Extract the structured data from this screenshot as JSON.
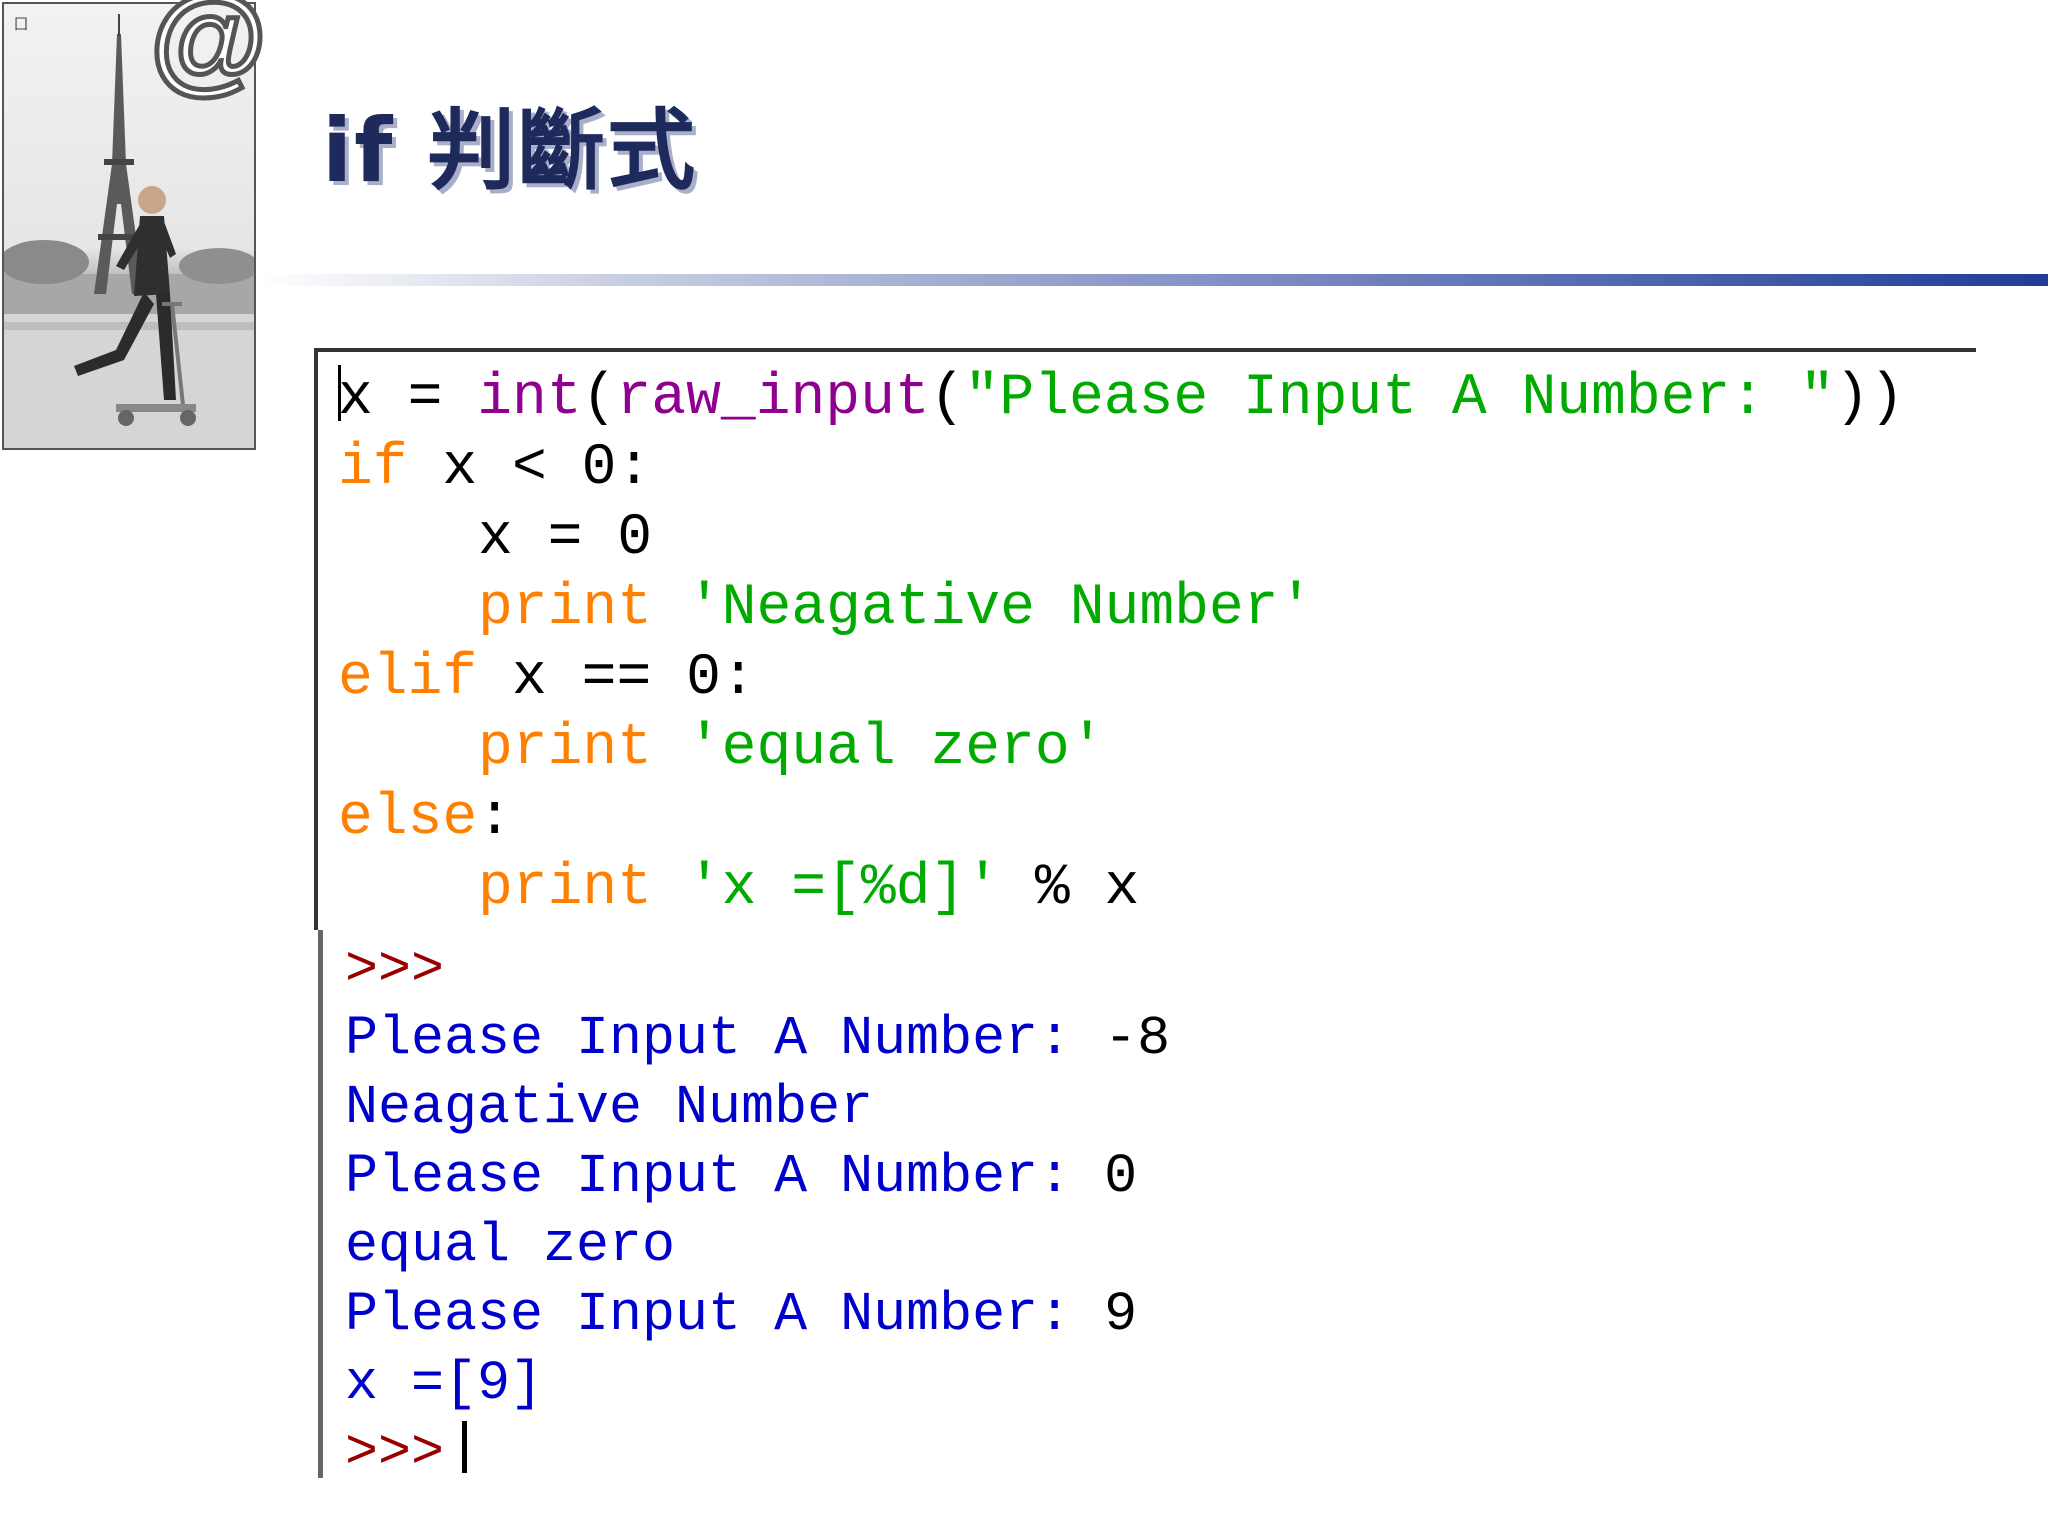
{
  "slide": {
    "title": "if 判斷式",
    "corner_mark": "囗"
  },
  "photo": {
    "icon": "at-sign-icon",
    "description_icon": "eiffel-tower-scooter-photo"
  },
  "code": {
    "line1": {
      "var": "x",
      "op": " = ",
      "func1": "int",
      "paren1": "(",
      "func2": "raw_input",
      "paren2": "(",
      "string": "\"Please Input A Number: \"",
      "close": "))"
    },
    "line2": {
      "kw": "if",
      "rest": " x < 0:"
    },
    "line3": {
      "rest": "x = 0"
    },
    "line4": {
      "kw": "print",
      "sp": " ",
      "string": "'Neagative Number'"
    },
    "line5": {
      "kw": "elif",
      "rest": " x == 0:"
    },
    "line6": {
      "kw": "print",
      "sp": " ",
      "string": "'equal zero'"
    },
    "line7": {
      "kw": "else",
      "rest": ":"
    },
    "line8": {
      "kw": "print",
      "sp": " ",
      "string": "'x =[%d]'",
      "rest": " % x"
    }
  },
  "shell": {
    "prompt1": ">>>",
    "out1_label": "Please Input A Number: ",
    "out1_value": "-8",
    "out2": "Neagative Number",
    "out3_label": "Please Input A Number: ",
    "out3_value": "0",
    "out4": "equal zero",
    "out5_label": "Please Input A Number: ",
    "out5_value": "9",
    "out6": "x =[9]",
    "prompt2": ">>>"
  },
  "colors": {
    "keyword": "#ff7f00",
    "builtin": "#900090",
    "string": "#00aa00",
    "shell_output": "#0000cc",
    "shell_prompt": "#990000",
    "title": "#1f2a5c"
  }
}
